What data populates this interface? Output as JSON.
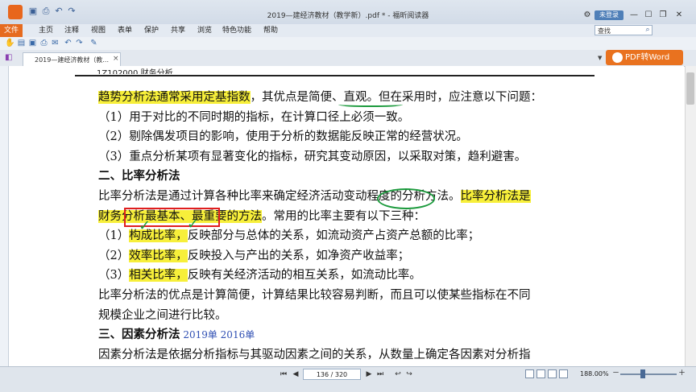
{
  "window": {
    "title": "2019—建经济教材（教学新）.pdf * - 福昕阅读器",
    "login_label": "未登录",
    "controls": [
      "⌂",
      "—",
      "☐",
      "✕"
    ]
  },
  "menu": {
    "file": "文件",
    "items": [
      "主页",
      "注释",
      "视图",
      "表单",
      "保护",
      "共享",
      "浏览",
      "特色功能",
      "帮助"
    ]
  },
  "search": {
    "value": "查找"
  },
  "tab": {
    "label": "2019—建经济教材（教...",
    "close": "×"
  },
  "pdf_to_word": "PDF转Word",
  "document": {
    "header_cut": "1Z102000    财务分析",
    "lines": [
      {
        "parts": [
          {
            "t": "趋势分析法通常采用定基指数",
            "hl": true
          },
          {
            "t": "，其优点是简便、直观。但在采用时，应注意以下问题：",
            "hl": false
          }
        ]
      },
      {
        "parts": [
          {
            "t": "（1）用于对比的不同时期的指标，在计算口径上必须一致。",
            "hl": false
          }
        ]
      },
      {
        "parts": [
          {
            "t": "（2）剔除偶发项目的影响，使用于分析的数据能反映正常的经营状况。",
            "hl": false
          }
        ]
      },
      {
        "parts": [
          {
            "t": "（3）重点分析某项有显著变化的指标，研究其变动原因，以采取对策，趋利避害。",
            "hl": false
          }
        ]
      },
      {
        "parts": [
          {
            "t": "二、比率分析法",
            "hl": false,
            "bold": true
          }
        ]
      },
      {
        "parts": [
          {
            "t": "比率分析法是通过计算各种比率来确定经济活动变动程度的分析方法。",
            "hl": false
          },
          {
            "t": "比率分析法是",
            "hl": true
          }
        ]
      },
      {
        "parts": [
          {
            "t": "财务分析最基本、最重要的方法",
            "hl": true
          },
          {
            "t": "。常用的比率主要有以下三种：",
            "hl": false
          }
        ]
      },
      {
        "parts": [
          {
            "t": "（1）",
            "hl": false
          },
          {
            "t": "构成比率，",
            "hl": true
          },
          {
            "t": "反映部分与总体的关系，如流动资产占资产总额的比率；",
            "hl": false
          }
        ]
      },
      {
        "parts": [
          {
            "t": "（2）",
            "hl": false
          },
          {
            "t": "效率比率，",
            "hl": true
          },
          {
            "t": "反映投入与产出的关系，如净资产收益率；",
            "hl": false
          }
        ]
      },
      {
        "parts": [
          {
            "t": "（3）",
            "hl": false
          },
          {
            "t": "相关比率，",
            "hl": true
          },
          {
            "t": "反映有关经济活动的相互关系，如流动比率。",
            "hl": false
          }
        ]
      },
      {
        "parts": [
          {
            "t": "比率分析法的优点是计算简便，计算结果比较容易判断，而且可以使某些指标在不同",
            "hl": false
          }
        ]
      },
      {
        "parts": [
          {
            "t": "规模企业之间进行比较。",
            "hl": false
          }
        ]
      },
      {
        "parts": [
          {
            "t": "三、因素分析法",
            "hl": false,
            "bold": true
          },
          {
            "t": "  2019单  2016单",
            "hl": false,
            "blue": true
          }
        ]
      },
      {
        "parts": [
          {
            "t": "因素分析法是依据分析指标与其驱动因素之间的关系，从数量上确定各因素对分析指",
            "hl": false
          }
        ]
      }
    ]
  },
  "status": {
    "page": "136 / 320",
    "zoom": "188.00%"
  }
}
